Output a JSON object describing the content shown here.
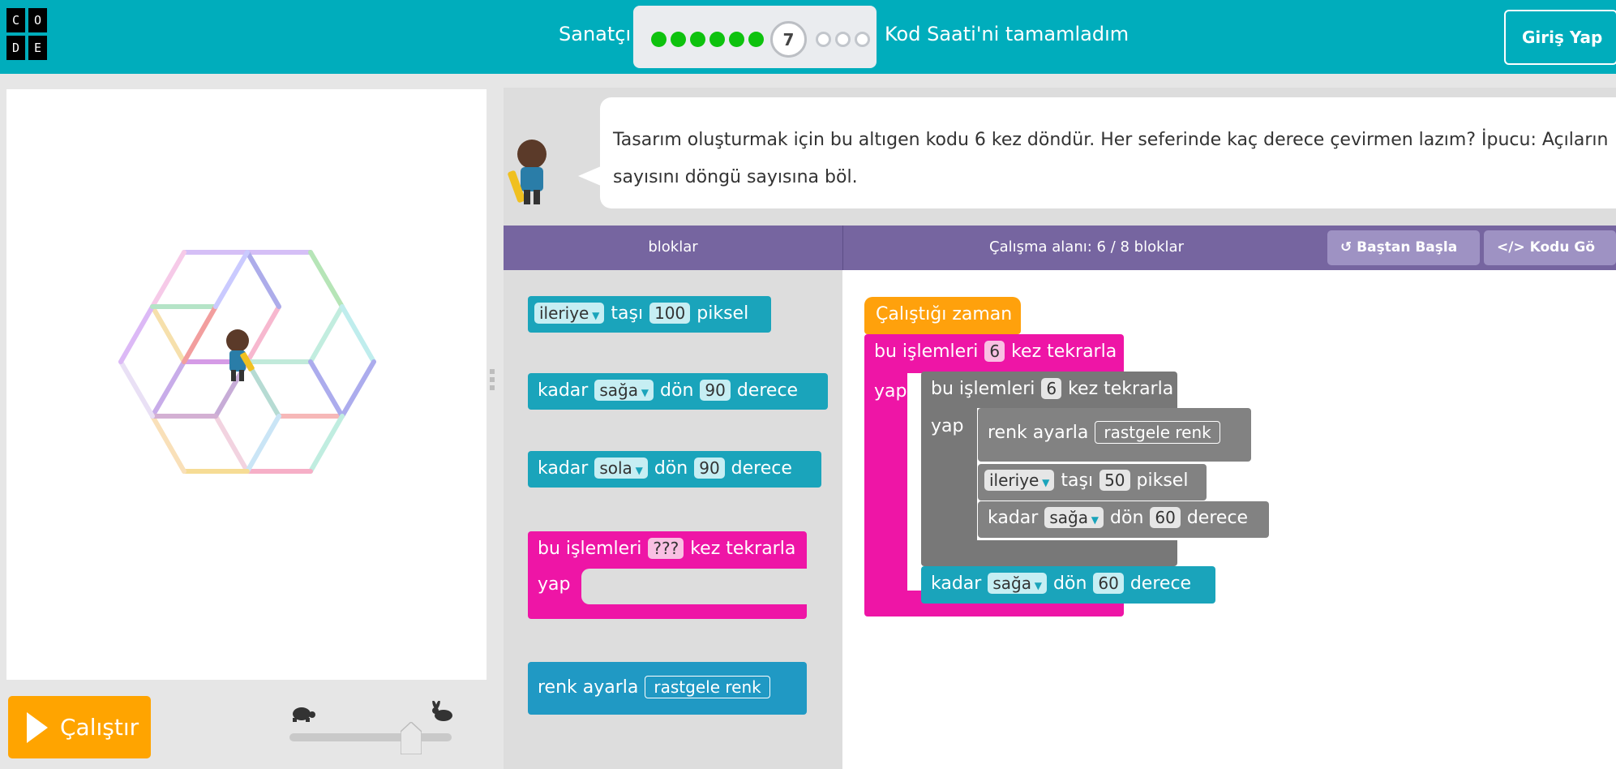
{
  "header": {
    "logo_letters": [
      "C",
      "O",
      "D",
      "E"
    ],
    "level_label": "Sanatçı",
    "current_level": "7",
    "completed_levels": 6,
    "total_levels": 10,
    "done_label": "Kod Saati'ni tamamladım",
    "signin_label": "Giriş Yap"
  },
  "canvas": {
    "run_label": "Çalıştır",
    "speed_fraction": 0.75
  },
  "instructions": {
    "text": "Tasarım oluşturmak için bu altıgen kodu 6 kez döndür. Her seferinde kaç derece çevirmen lazım? İpucu: Açıların sayısını döngü sayısına böl."
  },
  "workspace_header": {
    "toolbox_title": "bloklar",
    "workspace_title": "Çalışma alanı: 6 / 8 bloklar",
    "reset_label": "Baştan Başla",
    "code_label": "Kodu Gö"
  },
  "toolbox": {
    "move": {
      "dir": "ileriye",
      "word": "taşı",
      "val": "100",
      "unit": "piksel"
    },
    "turn_right": {
      "pre": "kadar",
      "dir": "sağa",
      "word": "dön",
      "val": "90",
      "unit": "derece"
    },
    "turn_left": {
      "pre": "kadar",
      "dir": "sola",
      "word": "dön",
      "val": "90",
      "unit": "derece"
    },
    "repeat": {
      "pre": "bu işlemleri",
      "val": "???",
      "post": "kez tekrarla",
      "do": "yap"
    },
    "color": {
      "pre": "renk ayarla",
      "val": "rastgele renk"
    }
  },
  "program": {
    "when_run": "Çalıştığı zaman",
    "outer": {
      "pre": "bu işlemleri",
      "val": "6",
      "post": "kez tekrarla",
      "do": "yap"
    },
    "inner": {
      "pre": "bu işlemleri",
      "val": "6",
      "post": "kez tekrarla",
      "do": "yap"
    },
    "color": {
      "pre": "renk ayarla",
      "val": "rastgele renk"
    },
    "move": {
      "dir": "ileriye",
      "word": "taşı",
      "val": "50",
      "unit": "piksel"
    },
    "turn_inner": {
      "pre": "kadar",
      "dir": "sağa",
      "word": "dön",
      "val": "60",
      "unit": "derece"
    },
    "turn_outer": {
      "pre": "kadar",
      "dir": "sağa",
      "word": "dön",
      "val": "60",
      "unit": "derece"
    }
  }
}
